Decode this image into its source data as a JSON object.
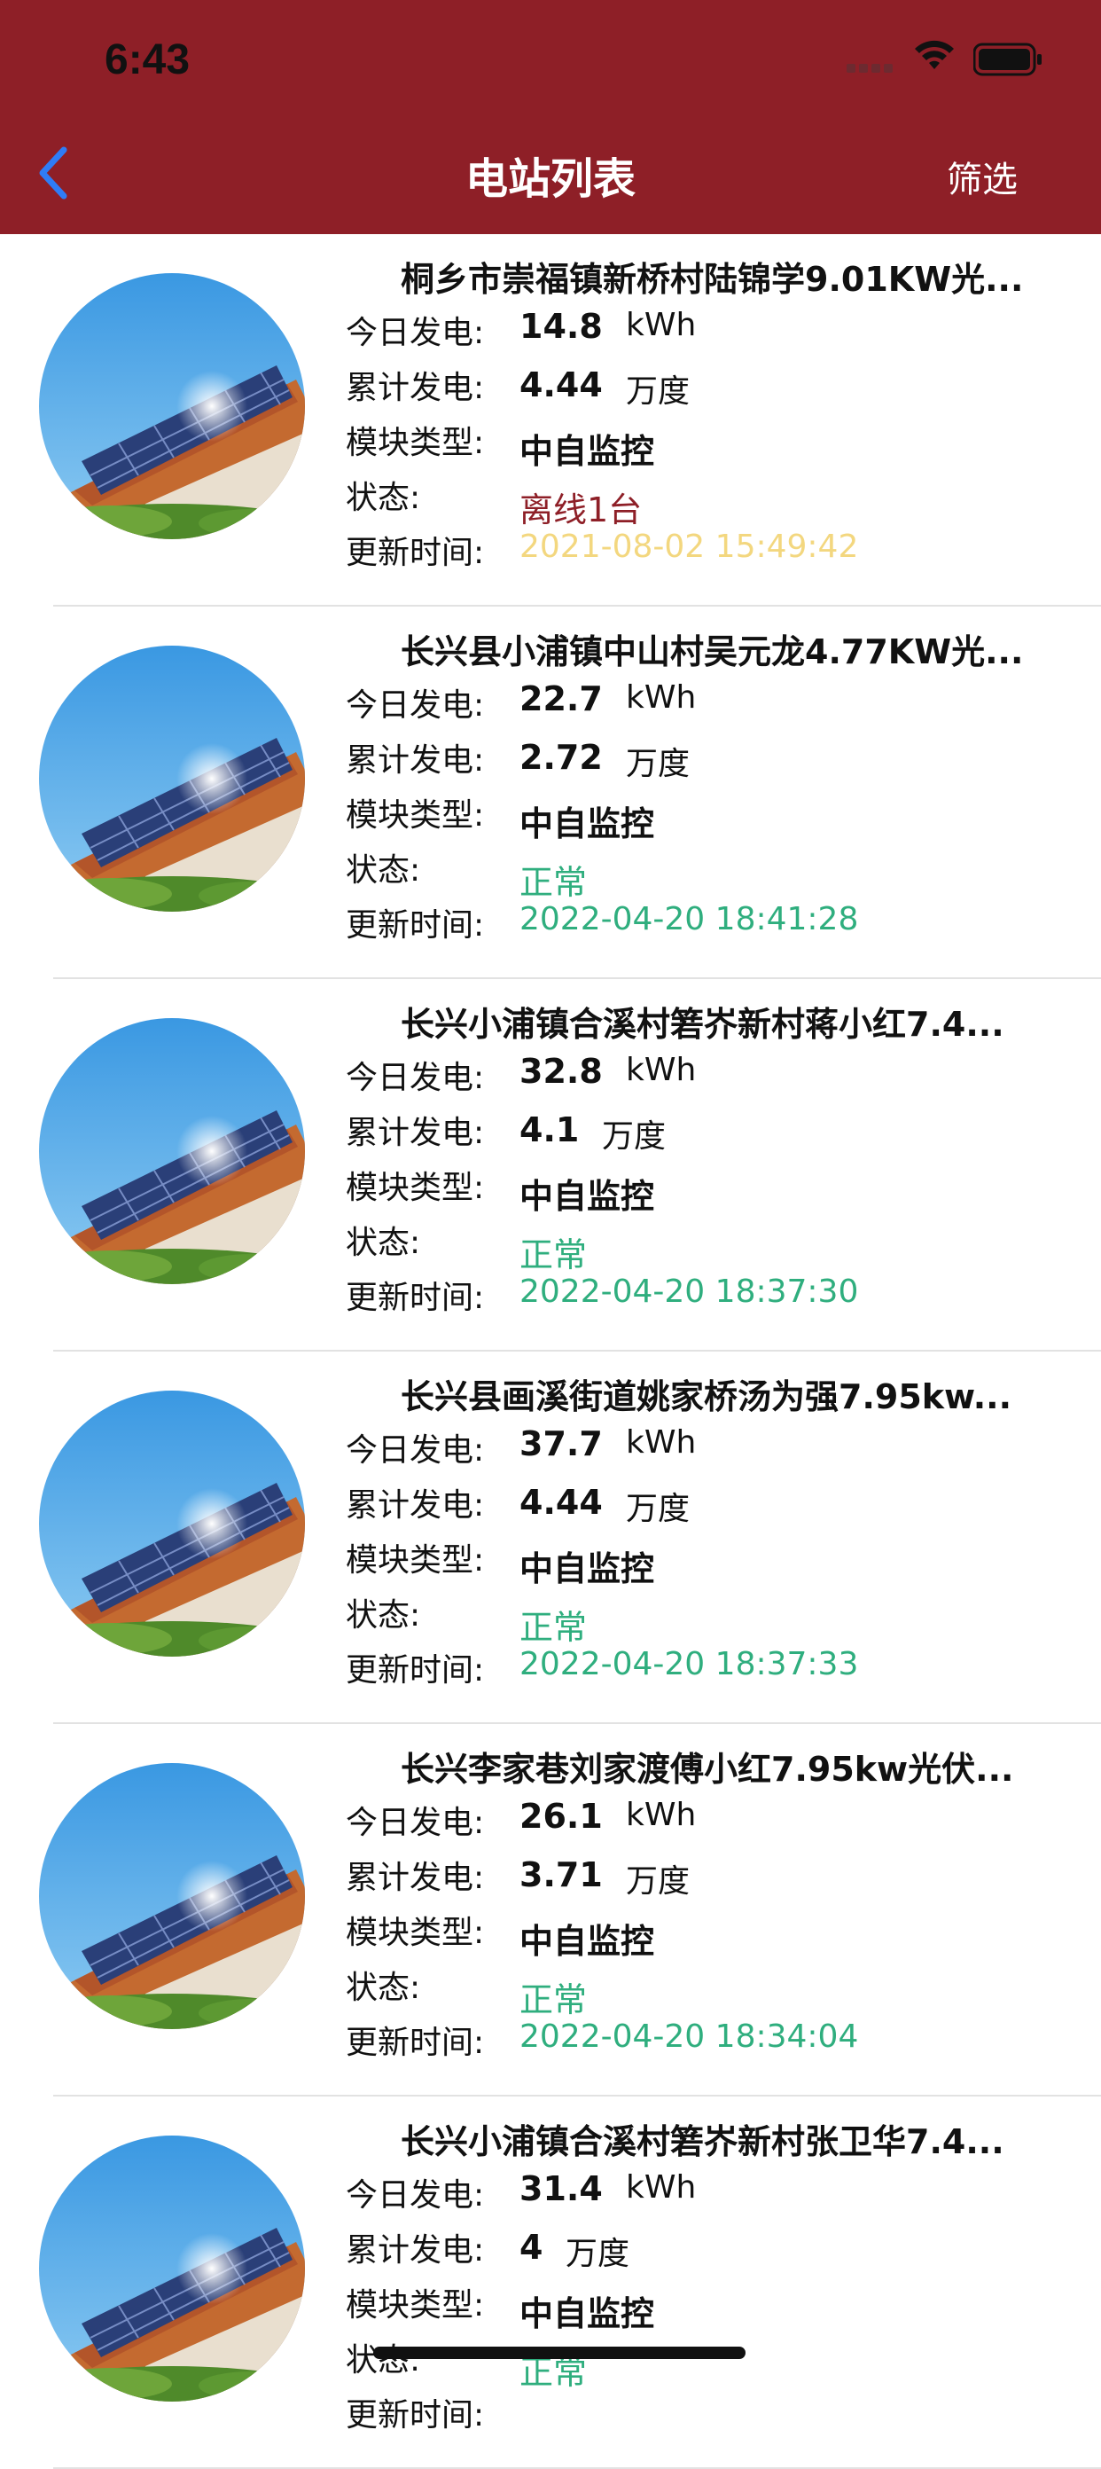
{
  "status_bar": {
    "time": "6:43"
  },
  "nav": {
    "title": "电站列表",
    "filter_label": "筛选"
  },
  "labels": {
    "today": "今日发电:",
    "total": "累计发电:",
    "module": "模块类型:",
    "status": "状态:",
    "updated": "更新时间:"
  },
  "stations": [
    {
      "name": "桐乡市崇福镇新桥村陆锦学9.01KW光...",
      "today": "14.8",
      "today_unit": "kWh",
      "total": "4.44",
      "total_unit": "万度",
      "module": "中自监控",
      "status": "离线1台",
      "updated": "2021-08-02 15:49:42"
    },
    {
      "name": "长兴县小浦镇中山村吴元龙4.77KW光...",
      "today": "22.7",
      "today_unit": "kWh",
      "total": "2.72",
      "total_unit": "万度",
      "module": "中自监控",
      "status": "正常",
      "updated": "2022-04-20 18:41:28"
    },
    {
      "name": "长兴小浦镇合溪村箬岕新村蒋小红7.4...",
      "today": "32.8",
      "today_unit": "kWh",
      "total": "4.1",
      "total_unit": "万度",
      "module": "中自监控",
      "status": "正常",
      "updated": "2022-04-20 18:37:30"
    },
    {
      "name": "长兴县画溪街道姚家桥汤为强7.95kw...",
      "today": "37.7",
      "today_unit": "kWh",
      "total": "4.44",
      "total_unit": "万度",
      "module": "中自监控",
      "status": "正常",
      "updated": "2022-04-20 18:37:33"
    },
    {
      "name": "长兴李家巷刘家渡傅小红7.95kw光伏...",
      "today": "26.1",
      "today_unit": "kWh",
      "total": "3.71",
      "total_unit": "万度",
      "module": "中自监控",
      "status": "正常",
      "updated": "2022-04-20 18:34:04"
    },
    {
      "name": "长兴小浦镇合溪村箬岕新村张卫华7.4...",
      "today": "31.4",
      "today_unit": "kWh",
      "total": "4",
      "total_unit": "万度",
      "module": "中自监控",
      "status": "正常",
      "updated": ""
    }
  ]
}
